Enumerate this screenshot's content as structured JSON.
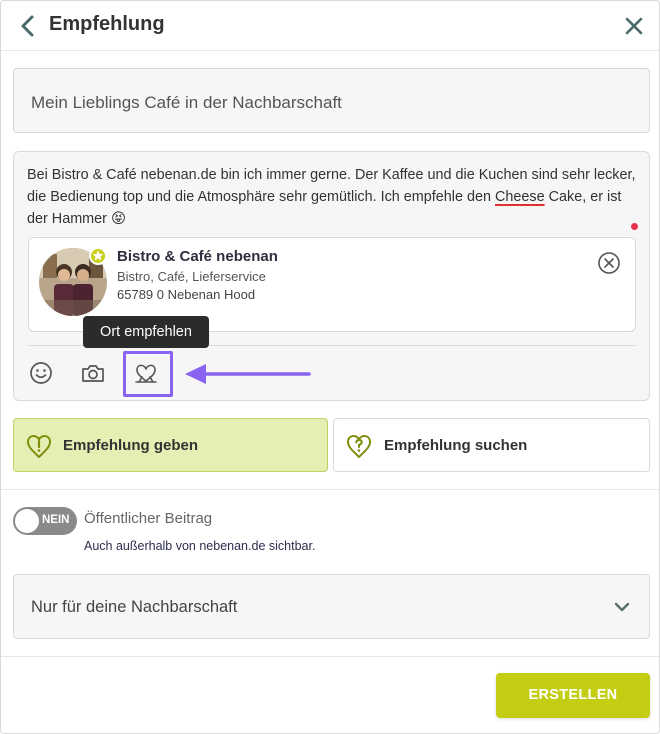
{
  "header": {
    "title": "Empfehlung",
    "back_icon": "chevron-left-icon",
    "close_icon": "close-icon"
  },
  "subject": {
    "value": "Mein Lieblings Café in der Nachbarschaft"
  },
  "message": {
    "text_before": "Bei Bistro & Café nebenan.de bin ich immer gerne. Der Kaffee und die Kuchen sind sehr lecker, die Bedienung top und die Atmosphäre sehr gemütlich. Ich empfehle den ",
    "misspelled": "Cheese",
    "text_after": " Cake, er ist der Hammer 😝"
  },
  "place": {
    "name": "Bistro & Café nebenan",
    "categories": "Bistro, Café, Lieferservice",
    "address": "65789 0  Nebenan Hood"
  },
  "toolbar": {
    "items": [
      "emoji-icon",
      "camera-icon",
      "place-recommend-icon"
    ],
    "tooltip": "Ort empfehlen"
  },
  "choices": {
    "give_label": "Empfehlung geben",
    "search_label": "Empfehlung suchen"
  },
  "visibility": {
    "toggle_text": "NEIN",
    "label": "Öffentlicher Beitrag",
    "hint": "Auch außerhalb von nebenan.de sichtbar."
  },
  "audience": {
    "selected": "Nur für deine Nachbarschaft"
  },
  "submit": {
    "label": "ERSTELLEN"
  },
  "colors": {
    "accent": "#c3ce12",
    "accent_light": "#e5efb4",
    "highlight": "#8a64f0",
    "tooltip_bg": "#2b2b2b",
    "spell_error": "#e03030"
  }
}
